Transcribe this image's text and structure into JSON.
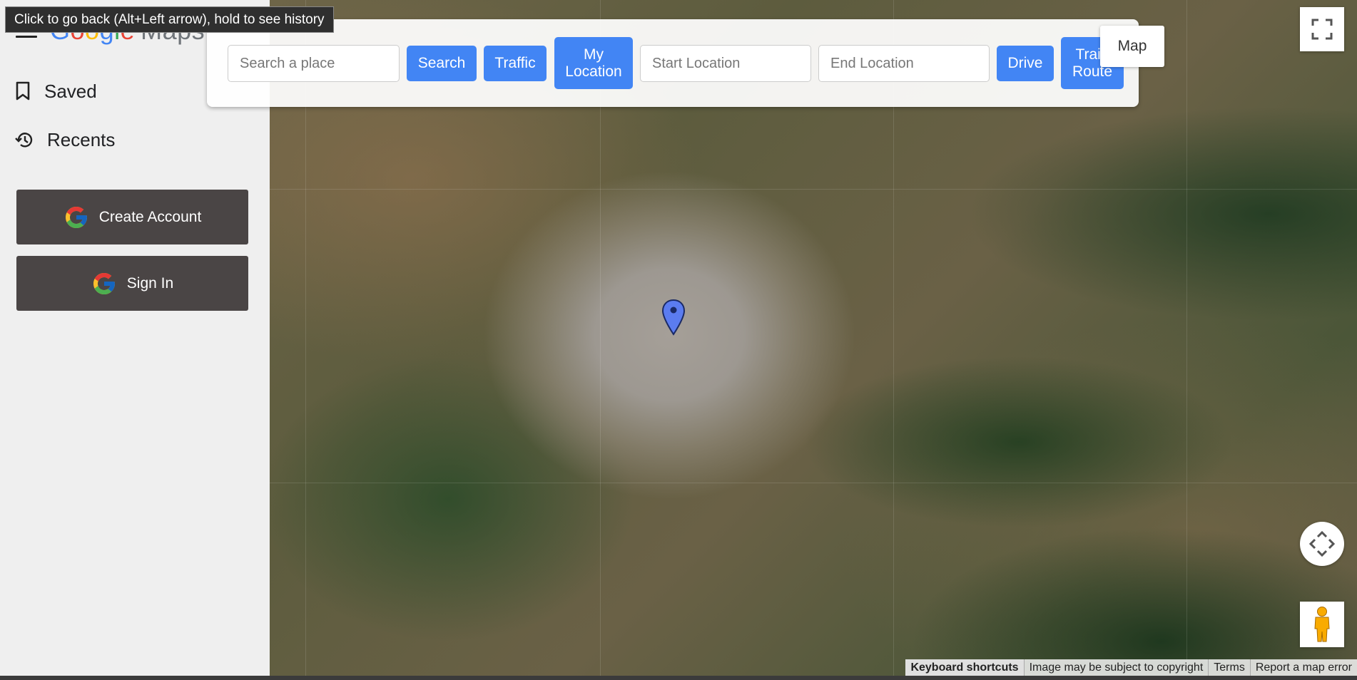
{
  "app": {
    "logo_google": [
      "G",
      "o",
      "o",
      "g",
      "l",
      "e"
    ],
    "logo_maps": "Maps"
  },
  "sidebar": {
    "items": [
      {
        "label": "Saved",
        "icon": "bookmark-icon"
      },
      {
        "label": "Recents",
        "icon": "history-icon"
      }
    ],
    "create_account_label": "Create Account",
    "sign_in_label": "Sign In"
  },
  "toolbar": {
    "search_placeholder": "Search a place",
    "search_label": "Search",
    "traffic_label": "Traffic",
    "my_location_label": "My Location",
    "start_placeholder": "Start Location",
    "end_placeholder": "End Location",
    "drive_label": "Drive",
    "train_route_label": "Train Route"
  },
  "map": {
    "map_type_label": "Map",
    "accent_color": "#4285f4",
    "pin_color": "#5b7cf0"
  },
  "footer": {
    "keyboard_shortcuts": "Keyboard shortcuts",
    "copyright": "Image may be subject to copyright",
    "terms": "Terms",
    "report": "Report a map error"
  },
  "tooltip": {
    "text": "Click to go back (Alt+Left arrow), hold to see history"
  }
}
